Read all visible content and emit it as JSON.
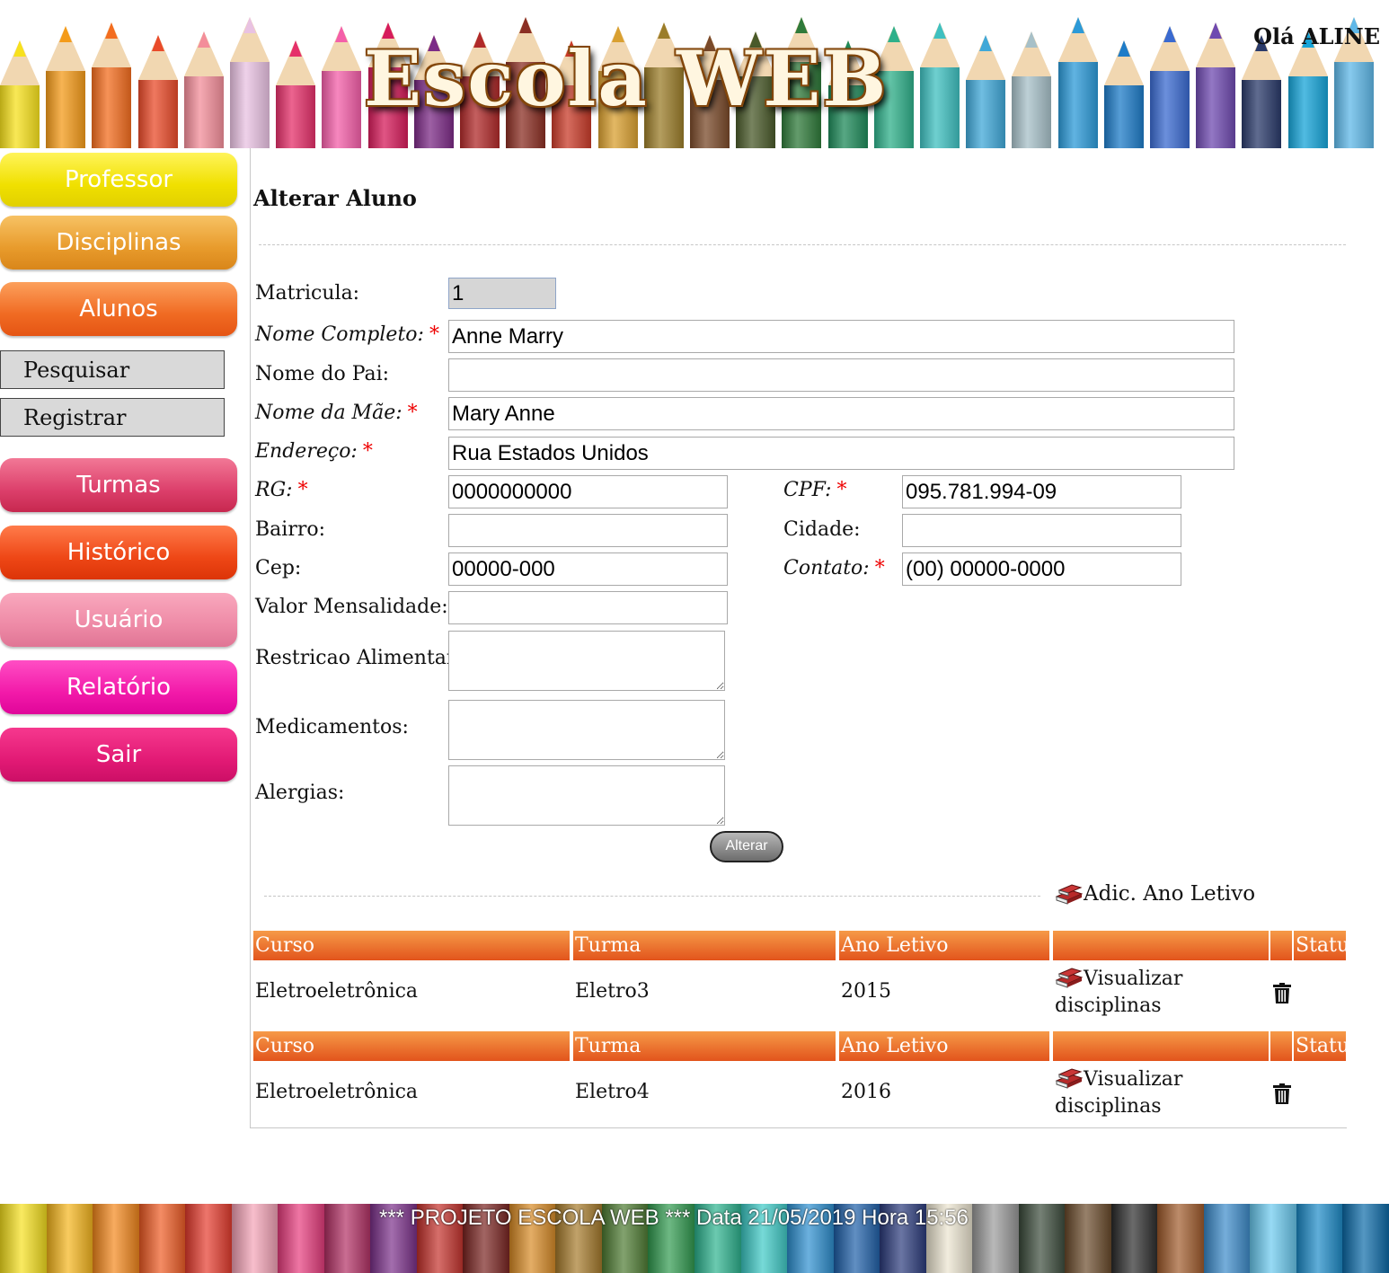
{
  "header": {
    "logo": "Escola WEB",
    "greeting": "Olá ALINE"
  },
  "sidebar": {
    "items": [
      {
        "label": "Professor"
      },
      {
        "label": "Disciplinas"
      },
      {
        "label": "Alunos"
      },
      {
        "label": "Pesquisar"
      },
      {
        "label": "Registrar"
      },
      {
        "label": "Turmas"
      },
      {
        "label": "Histórico"
      },
      {
        "label": "Usuário"
      },
      {
        "label": "Relatório"
      },
      {
        "label": "Sair"
      }
    ]
  },
  "form": {
    "title": "Alterar Aluno",
    "required_mark": "*",
    "matricula": {
      "label": "Matricula:",
      "value": "1"
    },
    "nome": {
      "label": "Nome Completo:",
      "value": "Anne Marry"
    },
    "pai": {
      "label": "Nome do Pai:",
      "value": ""
    },
    "mae": {
      "label": "Nome da Mãe:",
      "value": "Mary Anne"
    },
    "endereco": {
      "label": "Endereço:",
      "value": "Rua Estados Unidos"
    },
    "rg": {
      "label": "RG:",
      "value": "0000000000"
    },
    "cpf": {
      "label": "CPF:",
      "value": "095.781.994-09"
    },
    "bairro": {
      "label": "Bairro:",
      "value": ""
    },
    "cidade": {
      "label": "Cidade:",
      "value": ""
    },
    "cep": {
      "label": "Cep:",
      "value": "00000-000"
    },
    "contato": {
      "label": "Contato:",
      "value": "(00) 00000-0000"
    },
    "mensalidade": {
      "label": "Valor Mensalidade:",
      "value": ""
    },
    "restricao": {
      "label": "Restricao Alimentar:",
      "value": ""
    },
    "medicamentos": {
      "label": "Medicamentos:",
      "value": ""
    },
    "alergias": {
      "label": "Alergias:",
      "value": ""
    },
    "submit_label": "Alterar"
  },
  "enrollments": {
    "add_label": "Adic. Ano Letivo",
    "columns": [
      "Curso",
      "Turma",
      "Ano Letivo",
      "",
      "",
      "Status"
    ],
    "rows": [
      {
        "curso": "Eletroeletrônica",
        "turma": "Eletro3",
        "ano": "2015",
        "action_line1": "Visualizar",
        "action_line2": "disciplinas"
      },
      {
        "curso": "Eletroeletrônica",
        "turma": "Eletro4",
        "ano": "2016",
        "action_line1": "Visualizar",
        "action_line2": "disciplinas"
      }
    ]
  },
  "footer": {
    "text": "*** PROJETO ESCOLA WEB *** Data 21/05/2019 Hora 15:56"
  }
}
